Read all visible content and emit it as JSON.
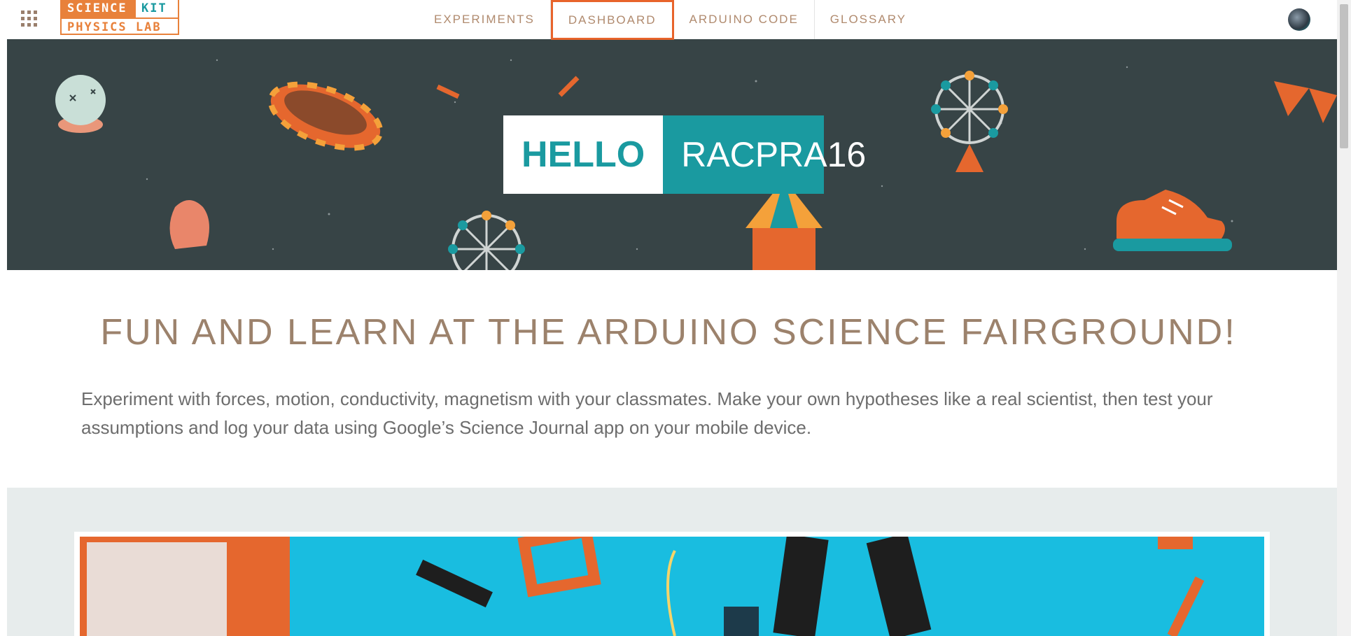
{
  "logo": {
    "line1_a": "SCIENCE",
    "line1_b": "KIT",
    "line2": "PHYSICS LAB"
  },
  "nav": {
    "items": [
      "EXPERIMENTS",
      "DASHBOARD",
      "ARDUINO CODE",
      "GLOSSARY"
    ],
    "active": "DASHBOARD"
  },
  "hero": {
    "hello": "HELLO",
    "username": "RACPRA16"
  },
  "main": {
    "headline": "FUN AND LEARN AT THE ARDUINO SCIENCE FAIRGROUND!",
    "intro": "Experiment with forces, motion, conductivity, magnetism with your classmates. Make your own hypotheses like a real scientist, then test your assumptions and log your data using Google’s Science Journal app on your mobile device."
  },
  "colors": {
    "accent_orange": "#e8813b",
    "accent_teal": "#1a9aa0",
    "hero_bg": "#374446",
    "text_brown": "#9c826c"
  },
  "icons": [
    "apps-grid-icon",
    "user-avatar-icon"
  ]
}
